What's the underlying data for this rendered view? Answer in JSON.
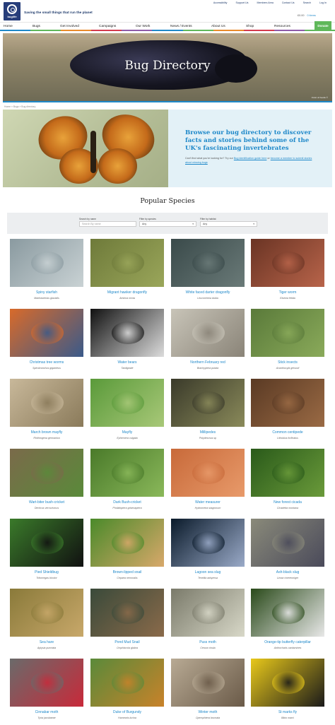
{
  "utility_nav": [
    "Accessibility",
    "Support Us",
    "Members Area",
    "Contact Us",
    "Search",
    "Log In"
  ],
  "logo": {
    "text": "buglife"
  },
  "tagline": "Saving the small things that run the planet",
  "basket": {
    "amount": "£0.00",
    "items": "0 items"
  },
  "main_nav": [
    "Home",
    "Bugs",
    "Get Involved",
    "Campaigns",
    "Our Work",
    "News / Events",
    "About Us",
    "Shop",
    "Resources"
  ],
  "donate_label": "Donate",
  "nav_colors": [
    "#1e88c9",
    "#5fb85a",
    "#e98a2b",
    "#d3394c",
    "#8e5aa8",
    "#1e88c9",
    "#5fb85a",
    "#e98a2b",
    "#d3394c",
    "#8e5aa8",
    "#5fb85a"
  ],
  "hero": {
    "title": "Bug Directory",
    "credit": "Violet oil beetle ©"
  },
  "breadcrumb": "Home » Bugs » Bug directory",
  "intro": {
    "heading": "Browse our bug directory to discover facts and stories behind some of the UK's fascinating invertebrates",
    "sub_prefix": "Can't find what you're looking for? Try our ",
    "sub_link1": "Bug identification guide here",
    "sub_mid": " or ",
    "sub_link2": "become a member to submit stories about missing bugs"
  },
  "popular_title": "Popular Species",
  "filters": {
    "name_label": "Search by name",
    "name_placeholder": "Search By name",
    "species_label": "Filter by species",
    "species_value": "Any",
    "habitat_label": "Filter by habitat",
    "habitat_value": "Any"
  },
  "species": [
    {
      "name": "Spiny starfish",
      "latin": "Marthasterias glacialis",
      "c1": "#8a9aa0",
      "c2": "#c9d2d4"
    },
    {
      "name": "Migrant hawker dragonfly",
      "latin": "Aeshna mixta",
      "c1": "#6e7a3a",
      "c2": "#9aa65a"
    },
    {
      "name": "White faced darter dragonfly",
      "latin": "Leucorrhinia dubia",
      "c1": "#3a4a4a",
      "c2": "#6a7a78"
    },
    {
      "name": "Tiger worm",
      "latin": "Eisenia fetida",
      "c1": "#6a3424",
      "c2": "#b8644a"
    },
    {
      "name": "Christmas tree worms",
      "latin": "Spirobranchus giganteus",
      "c1": "#d86a2a",
      "c2": "#3a5a8a"
    },
    {
      "name": "Water bears",
      "latin": "Tardigrade",
      "c1": "#111111",
      "c2": "#dcdcdc"
    },
    {
      "name": "Northern February red",
      "latin": "Brachyptera putata",
      "c1": "#c8c4b8",
      "c2": "#8a8478"
    },
    {
      "name": "Stick insects",
      "latin": "Acanthoxyla geisovii",
      "c1": "#5a7a3a",
      "c2": "#8aaa5a"
    },
    {
      "name": "March brown mayfly",
      "latin": "Rhithrogena germanica",
      "c1": "#c8b89a",
      "c2": "#8a7a5a"
    },
    {
      "name": "Mayfly",
      "latin": "Ephemera vulgata",
      "c1": "#5a9a3a",
      "c2": "#a8c878"
    },
    {
      "name": "Millipedes",
      "latin": "Polydesmus sp",
      "c1": "#3a3a2a",
      "c2": "#8a8a5a"
    },
    {
      "name": "Common centipede",
      "latin": "Lithobius forficatus",
      "c1": "#5a3a24",
      "c2": "#9a6a44"
    },
    {
      "name": "Wart-biter bush-cricket",
      "latin": "Decticus verrucivorus",
      "c1": "#7a6a4a",
      "c2": "#5a8a3a"
    },
    {
      "name": "Dark Bush-cricket",
      "latin": "Pholidoptera griseoaptera",
      "c1": "#4a7a2a",
      "c2": "#8ab85a"
    },
    {
      "name": "Water measurer",
      "latin": "Hydrometra stagnorum",
      "c1": "#c86a3a",
      "c2": "#e89a6a"
    },
    {
      "name": "New forest cicada",
      "latin": "Cicadetta montana",
      "c1": "#2a5a1a",
      "c2": "#6a9a3a"
    },
    {
      "name": "Pied Shieldbug",
      "latin": "Tritomegas bicolor",
      "c1": "#3a7a2a",
      "c2": "#111111"
    },
    {
      "name": "Brown-lipped snail",
      "latin": "Cepaea nemoralis",
      "c1": "#4a8a2a",
      "c2": "#d8a86a"
    },
    {
      "name": "Lagoon sea slug",
      "latin": "Tenellia adspersa",
      "c1": "#0a1a2a",
      "c2": "#9aaac8"
    },
    {
      "name": "Ash-black slug",
      "latin": "Limax cinereoniger",
      "c1": "#8a8a7a",
      "c2": "#4a4a5a"
    },
    {
      "name": "Sea hare",
      "latin": "Aplysia punctata",
      "c1": "#8a7a3a",
      "c2": "#c8a86a"
    },
    {
      "name": "Pond Mud Snail",
      "latin": "Omphiscola glabra",
      "c1": "#3a4a3a",
      "c2": "#8a6a4a"
    },
    {
      "name": "Puss moth",
      "latin": "Cerura vinula",
      "c1": "#7a7a6a",
      "c2": "#d8d8c8"
    },
    {
      "name": "Orange-tip butterfly caterpillar",
      "latin": "Anthocharis cardamines",
      "c1": "#2a4a1a",
      "c2": "#e8e8e8"
    },
    {
      "name": "Cinnabar moth",
      "latin": "Tyria jacobaeae",
      "c1": "#6a6a6a",
      "c2": "#c82a3a"
    },
    {
      "name": "Duke of Burgundy",
      "latin": "Hamearis lucina",
      "c1": "#5a8a3a",
      "c2": "#c8822a"
    },
    {
      "name": "Winter moth",
      "latin": "Operophtera brumata",
      "c1": "#b8aa94",
      "c2": "#6a5a48"
    },
    {
      "name": "St marks fly",
      "latin": "Bibio marci",
      "c1": "#e8c81a",
      "c2": "#1a1a1a"
    }
  ]
}
